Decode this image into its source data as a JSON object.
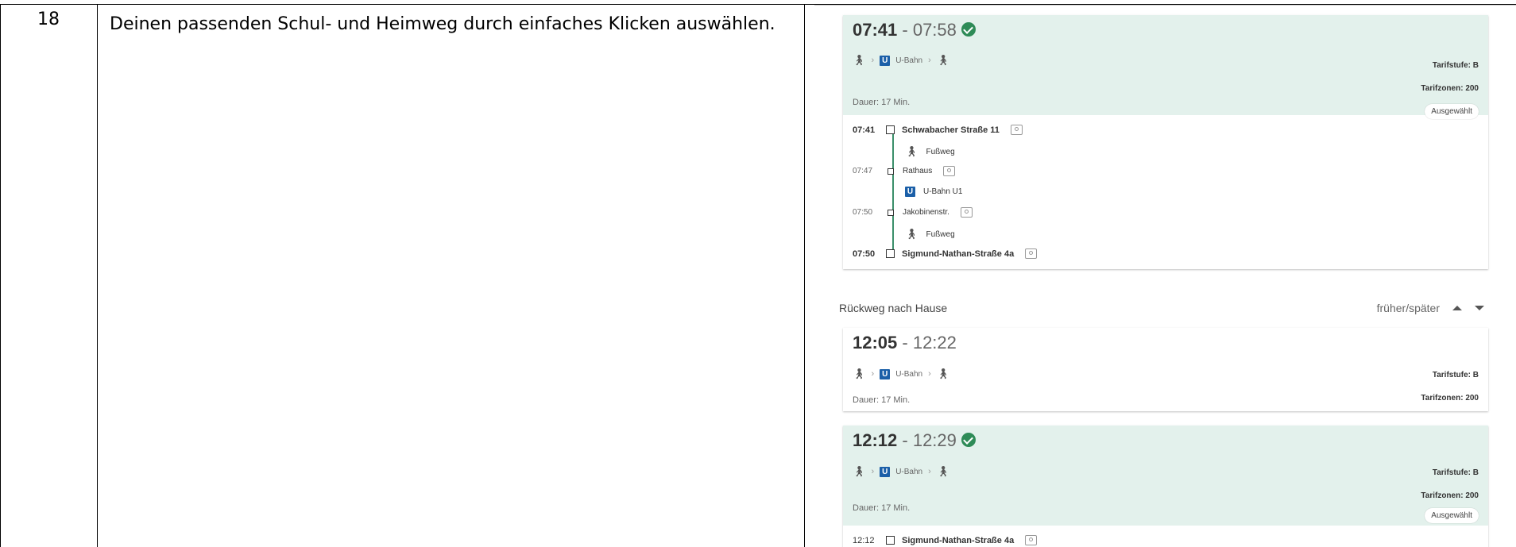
{
  "row": {
    "number": "18",
    "text": "Deinen passenden Schul- und Heimweg durch einfaches Klicken auswählen."
  },
  "accent": "#2e8b57",
  "selected_bg": "#e3f1ec",
  "ubahn_color": "#1b5fa8",
  "card1": {
    "time_start": "07:41",
    "time_end": " - 07:58",
    "mode_walk": "walk-icon",
    "mode_label": "U-Bahn",
    "duration": "Dauer: 17 Min.",
    "tarifstufe": "Tarifstufe: B",
    "tarifzonen": "Tarifzonen: 200",
    "badge": "Ausgewählt",
    "stops": [
      {
        "time": "07:41",
        "name": "Schwabacher Straße 11"
      },
      {
        "time": "07:47",
        "name": "Rathaus"
      },
      {
        "time": "07:50",
        "name": "Jakobinenstr."
      },
      {
        "time": "07:50",
        "name": "Sigmund-Nathan-Straße 4a"
      }
    ],
    "legs": [
      "Fußweg",
      "U-Bahn U1",
      "Fußweg"
    ]
  },
  "return": {
    "title": "Rückweg nach Hause",
    "nav": "früher/später"
  },
  "card2": {
    "time_start": "12:05",
    "time_end": " - 12:22",
    "mode_label": "U-Bahn",
    "duration": "Dauer: 17 Min.",
    "tarifstufe": "Tarifstufe: B",
    "tarifzonen": "Tarifzonen: 200"
  },
  "card3": {
    "time_start": "12:12",
    "time_end": " - 12:29",
    "mode_label": "U-Bahn",
    "duration": "Dauer: 17 Min.",
    "tarifstufe": "Tarifstufe: B",
    "tarifzonen": "Tarifzonen: 200",
    "badge": "Ausgewählt",
    "first_stop": {
      "time": "12:12",
      "name": "Sigmund-Nathan-Straße 4a"
    }
  }
}
